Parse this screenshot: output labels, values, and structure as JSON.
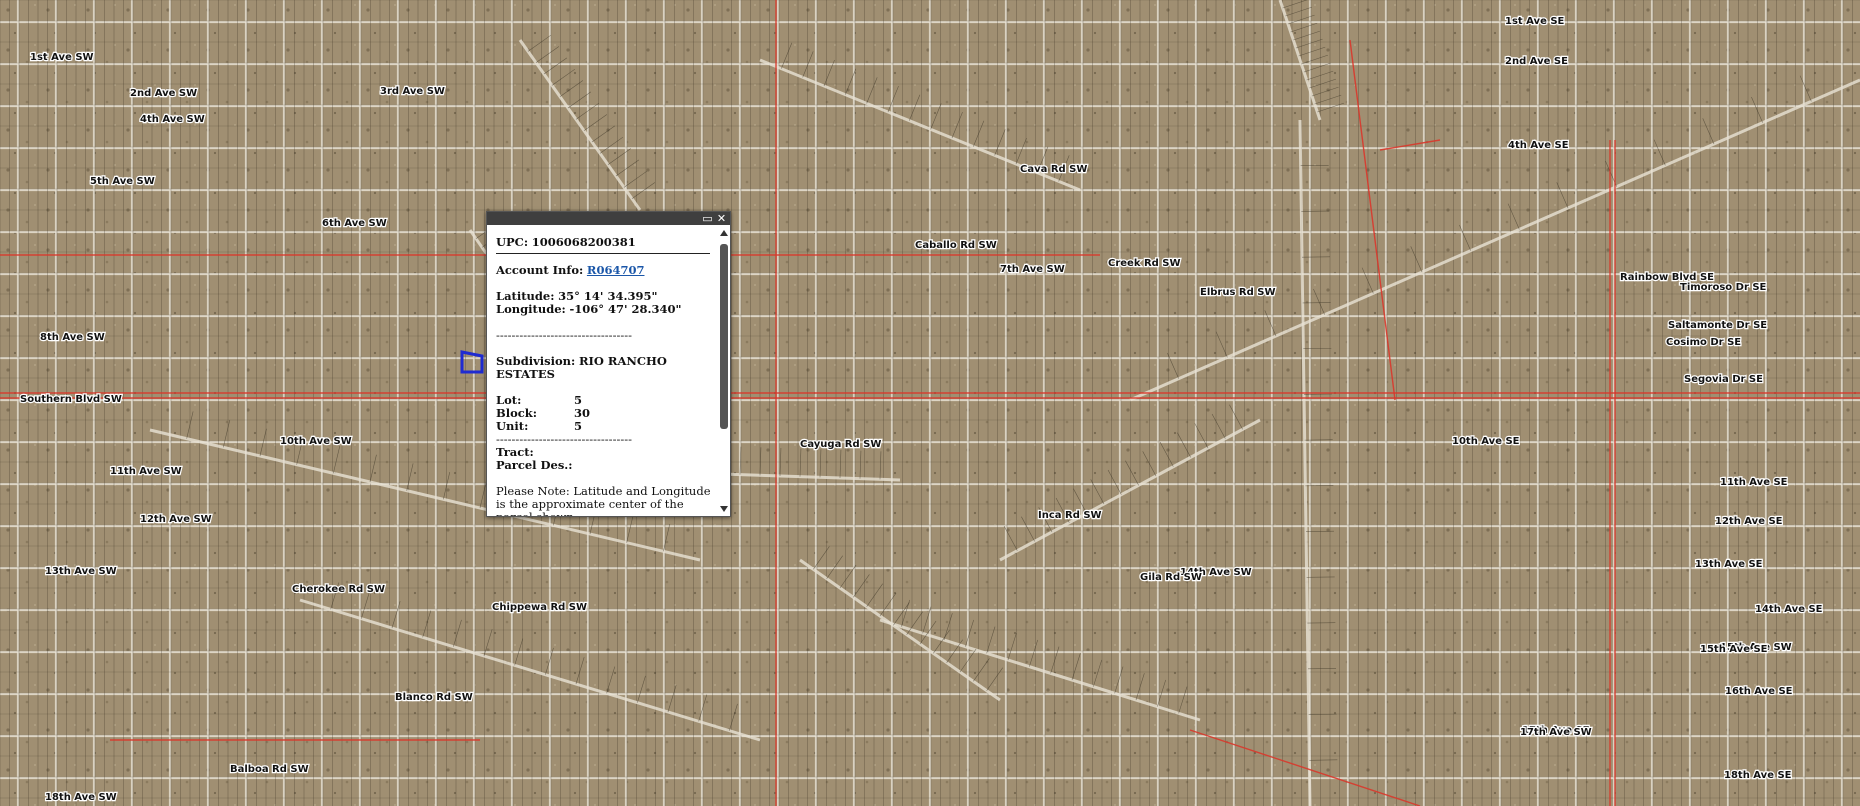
{
  "map": {
    "street_labels": [
      "1st Ave SW",
      "2nd Ave SW",
      "3rd Ave SW",
      "4th Ave SW",
      "5th Ave SW",
      "6th Ave SW",
      "7th Ave SW",
      "8th Ave SW",
      "Southern Blvd SW",
      "10th Ave SW",
      "11th Ave SW",
      "12th Ave SW",
      "13th Ave SW",
      "14th Ave SW",
      "15th Ave SW",
      "1st Ave SE",
      "2nd Ave SE",
      "4th Ave SE",
      "10th Ave SE",
      "11th Ave SE",
      "12th Ave SE",
      "13th Ave SE",
      "14th Ave SE",
      "15th Ave SE",
      "16th Ave SE",
      "17th Ave SE",
      "18th Ave SE",
      "17th Ave SW",
      "18th Ave SW",
      "Cava Rd SW",
      "Inca Rd SW",
      "Cherokee Rd SW",
      "Blanco Rd SW",
      "Balboa Rd SW",
      "Chippewa Rd SW",
      "Cayuga Rd SW",
      "Caballo Rd SW",
      "Creek Rd SW",
      "Elbrus Rd SW",
      "Gila Rd SW",
      "Rainbow Blvd SE",
      "Timoroso Dr SE",
      "Saltamonte Dr SE",
      "Cosimo Dr SE",
      "Segovia Dr SE"
    ],
    "boundary_color": "#d9372b",
    "selection_color": "#1f2bd1"
  },
  "popup": {
    "maximize_icon": "maximize-icon",
    "close_icon": "close-icon",
    "upc_label": "UPC:",
    "upc_value": "1006068200381",
    "account_label": "Account Info:",
    "account_link": "R064707",
    "latitude_label": "Latitude:",
    "latitude_value": "35° 14' 34.395\"",
    "longitude_label": "Longitude:",
    "longitude_value": "-106° 47' 28.340\"",
    "divider_1": "-----------------------------------",
    "subdivision_label": "Subdivision:",
    "subdivision_value": "RIO RANCHO ESTATES",
    "lot_label": "Lot:",
    "lot_value": "5",
    "block_label": "Block:",
    "block_value": "30",
    "unit_label": "Unit:",
    "unit_value": "5",
    "divider_2": "-----------------------------------",
    "tract_label": "Tract:",
    "parcel_label": "Parcel Des.:",
    "note": "Please Note: Latitude and Longitude is the approximate center of the parcel shown."
  }
}
